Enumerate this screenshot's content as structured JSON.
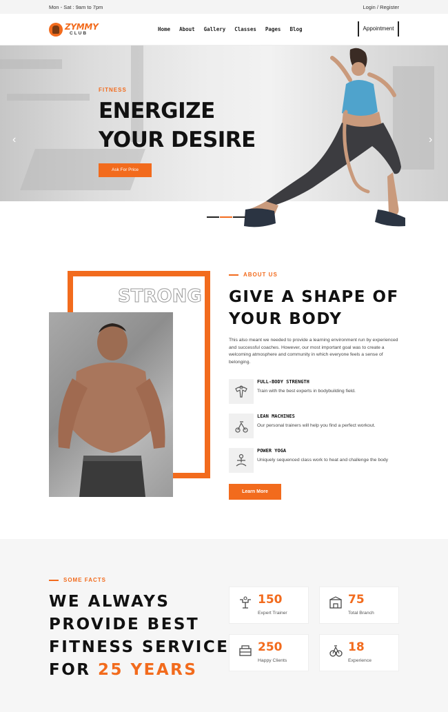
{
  "topbar": {
    "hours": "Mon - Sat : 9am to 7pm",
    "auth": "Login / Register"
  },
  "header": {
    "logo": {
      "name": "ZYMMY",
      "sub": "CLUB"
    },
    "nav": [
      "Home",
      "About",
      "Gallery",
      "Classes",
      "Pages",
      "Blog"
    ],
    "appointment": "Appointment"
  },
  "hero": {
    "tag": "FITNESS",
    "title_line1": "ENERGIZE",
    "title_line2": "YOUR DESIRE",
    "button": "Ask For Price",
    "prev_icon": "chevron-left-icon",
    "next_icon": "chevron-right-icon"
  },
  "about": {
    "image_text": "STRONG",
    "tag": "ABOUT US",
    "title_line1": "GIVE A SHAPE OF",
    "title_line2": "YOUR BODY",
    "text": "This also meant we needed to provide a learning environment run by experienced and successful coaches. However, our most important goal was to create a welcoming atmosphere and community in which everyone feels a sense of belonging.",
    "features": [
      {
        "icon": "strength-icon",
        "title": "FULL-BODY STRENGTH",
        "desc": "Train with the best experts in bodybuilding field."
      },
      {
        "icon": "bike-machine-icon",
        "title": "LEAN MACHINES",
        "desc": "Our personal trainers will help you find a perfect workout."
      },
      {
        "icon": "yoga-icon",
        "title": "POWER YOGA",
        "desc": "Uniquely sequenced class work to heat and challenge the body"
      }
    ],
    "button": "Learn More"
  },
  "facts": {
    "tag": "SOME FACTS",
    "title_line1": "WE ALWAYS",
    "title_line2": "PROVIDE BEST",
    "title_line3": "FITNESS SERVICE",
    "title_line4_prefix": "FOR ",
    "title_line4_highlight": "25 YEARS",
    "stats": [
      {
        "icon": "trainer-icon",
        "value": "150",
        "label": "Expert Trainer"
      },
      {
        "icon": "branch-icon",
        "value": "75",
        "label": "Total Branch"
      },
      {
        "icon": "clients-icon",
        "value": "250",
        "label": "Happy Clients"
      },
      {
        "icon": "experience-icon",
        "value": "18",
        "label": "Experience"
      }
    ]
  },
  "colors": {
    "accent": "#f26b1d",
    "dark": "#111111"
  }
}
